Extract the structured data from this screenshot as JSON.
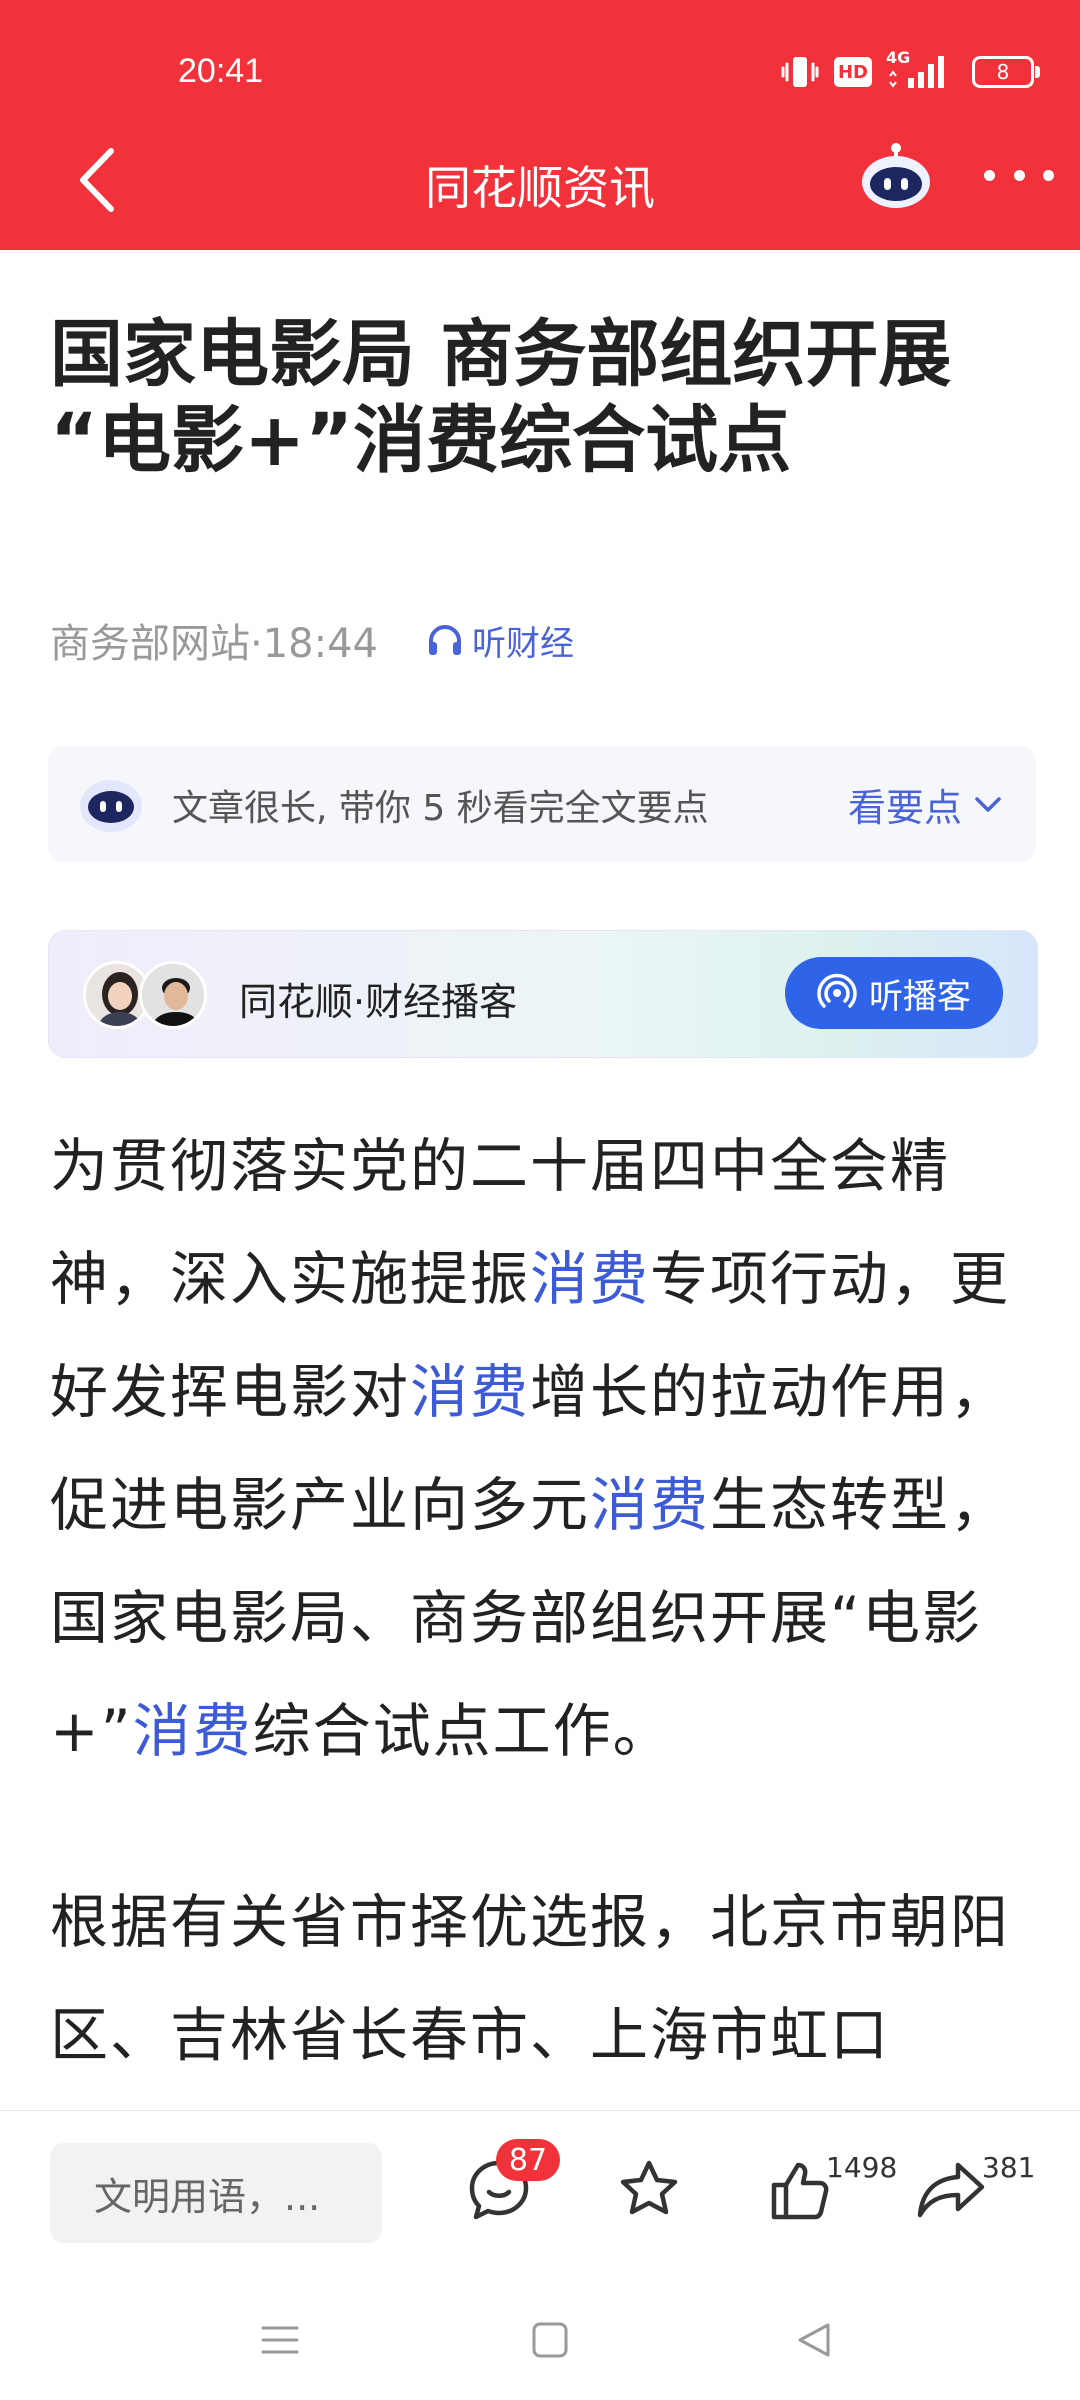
{
  "status_bar": {
    "time": "20:41",
    "hd_label": "HD",
    "network_label": "4G",
    "battery_level": "8"
  },
  "header": {
    "title": "同花顺资讯",
    "back_icon": "chevron-left-icon",
    "assistant_icon": "robot-assistant-icon",
    "more_icon": "more-dots-icon"
  },
  "article": {
    "headline_line1": "国家电影局 商务部组织开展",
    "headline_line2": "“电影+”消费综合试点",
    "source_time": "商务部网站·18:44",
    "listen_label": "听财经"
  },
  "summary": {
    "text": "文章很长, 带你 5 秒看完全文要点",
    "link_label": "看要点"
  },
  "podcast": {
    "title": "同花顺·财经播客",
    "button_label": "听播客"
  },
  "body": {
    "keyword": "消费",
    "p1": {
      "s1": "为贯彻落实党的二十届四中全会精神，深入实施提振",
      "s2": "专项行动，更好发挥电影对",
      "s3": "增长的拉动作用，促进电影产业向多元",
      "s4": "生态转型，国家电影局、商务部组织开展“电影+”",
      "s5": "综合试点工作。"
    },
    "p2": "根据有关省市择优选报，北京市朝阳区、吉林省长春市、上海市虹口"
  },
  "bottom_bar": {
    "comment_placeholder": "文明用语，...",
    "comment_count": "87",
    "like_count": "1498",
    "share_count": "381"
  },
  "colors": {
    "brand_red": "#f2323a",
    "link_blue": "#3d5bd6",
    "button_blue": "#2f64e8"
  }
}
